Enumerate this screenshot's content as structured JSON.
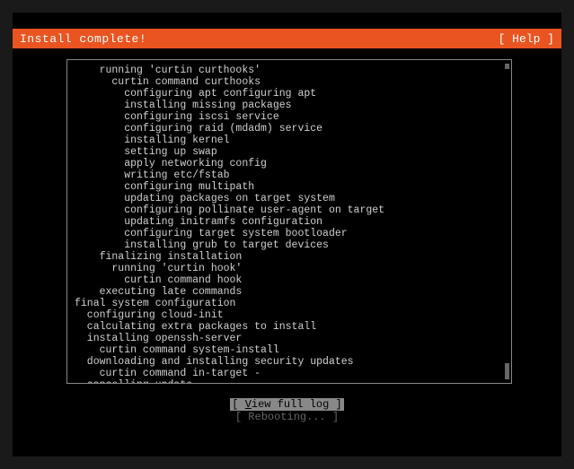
{
  "header": {
    "title": "Install complete!",
    "help_label": "[ Help ]"
  },
  "log": {
    "lines": [
      "    running 'curtin curthooks'",
      "      curtin command curthooks",
      "        configuring apt configuring apt",
      "        installing missing packages",
      "        configuring iscsi service",
      "        configuring raid (mdadm) service",
      "        installing kernel",
      "        setting up swap",
      "        apply networking config",
      "        writing etc/fstab",
      "        configuring multipath",
      "        updating packages on target system",
      "        configuring pollinate user-agent on target",
      "        updating initramfs configuration",
      "        configuring target system bootloader",
      "        installing grub to target devices",
      "    finalizing installation",
      "      running 'curtin hook'",
      "        curtin command hook",
      "    executing late commands",
      "final system configuration",
      "  configuring cloud-init",
      "  calculating extra packages to install",
      "  installing openssh-server",
      "    curtin command system-install",
      "  downloading and installing security updates",
      "    curtin command in-target -",
      "  cancelling update"
    ]
  },
  "footer": {
    "view_log_prefix": "[ ",
    "view_log_hotkey": "V",
    "view_log_rest": "iew full log ]",
    "rebooting_label": "[  Rebooting...  ]"
  }
}
